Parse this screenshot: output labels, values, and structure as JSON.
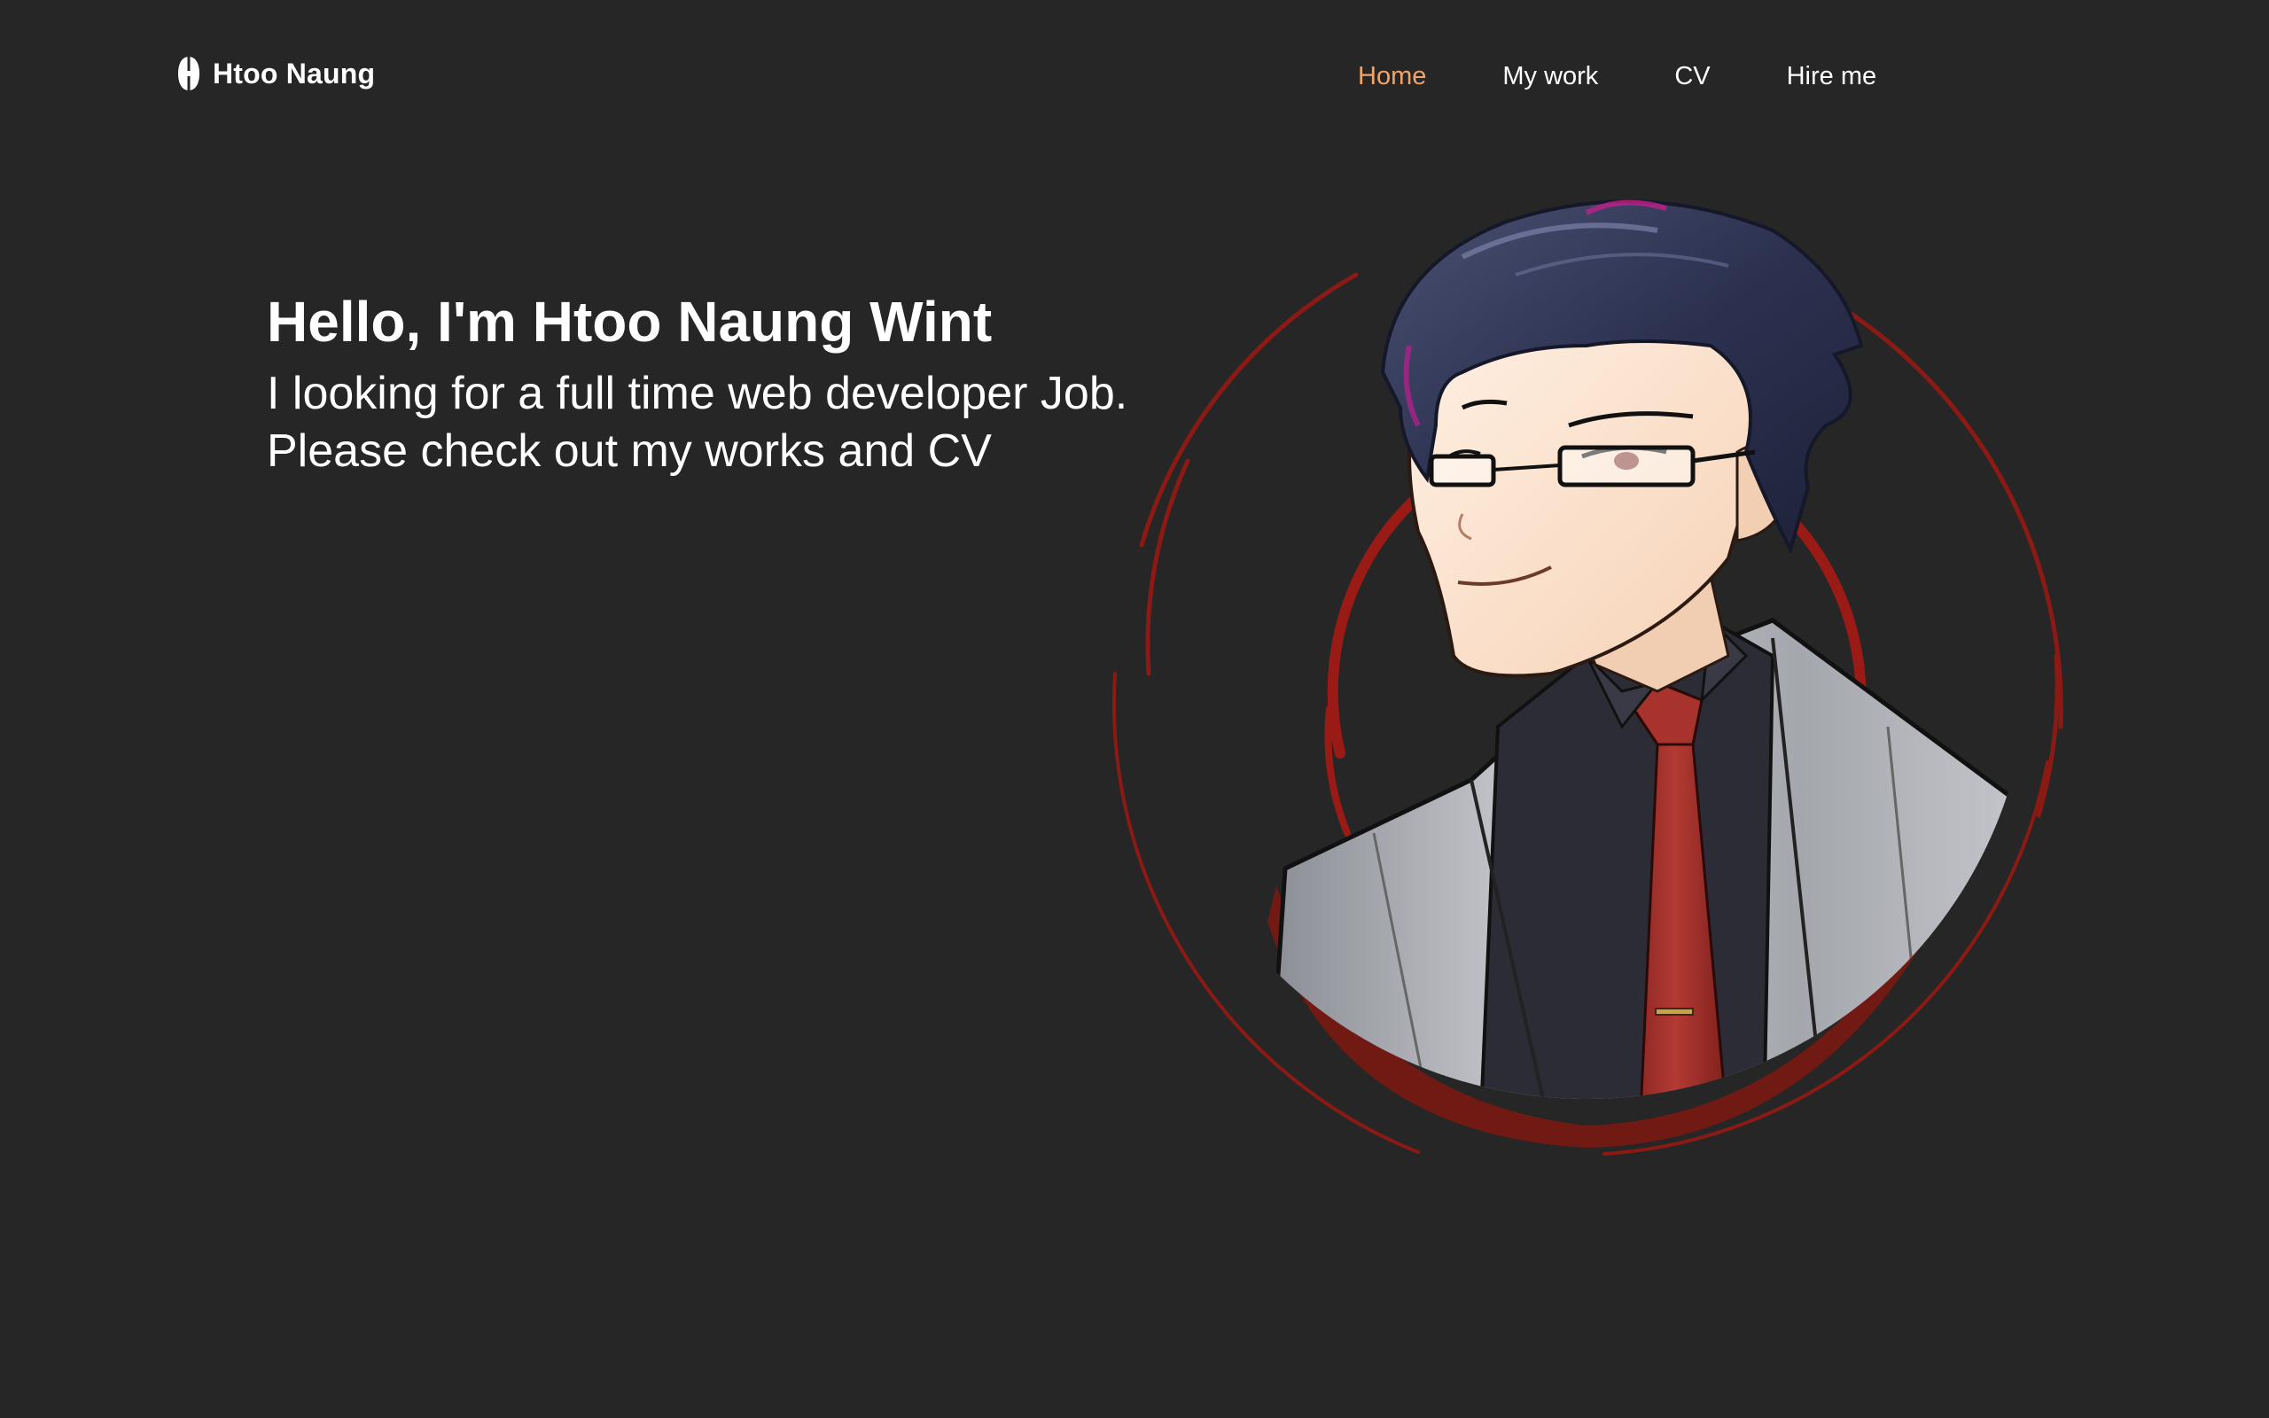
{
  "brand": {
    "name": "Htoo Naung",
    "logo_icon": "h-letter-logo-icon"
  },
  "nav": {
    "items": [
      {
        "label": "Home",
        "active": true
      },
      {
        "label": "My work",
        "active": false
      },
      {
        "label": "CV",
        "active": false
      },
      {
        "label": "Hire me",
        "active": false
      }
    ]
  },
  "hero": {
    "title": "Hello, I'm Htoo Naung Wint",
    "line1": "I looking for a full time web developer Job.",
    "line2": "Please check out my works and CV"
  },
  "avatar": {
    "icon": "anime-portrait-illustration"
  },
  "colors": {
    "background": "#262626",
    "accent": "#f2a36b",
    "text": "#ffffff",
    "ring": "#8b1a14"
  }
}
